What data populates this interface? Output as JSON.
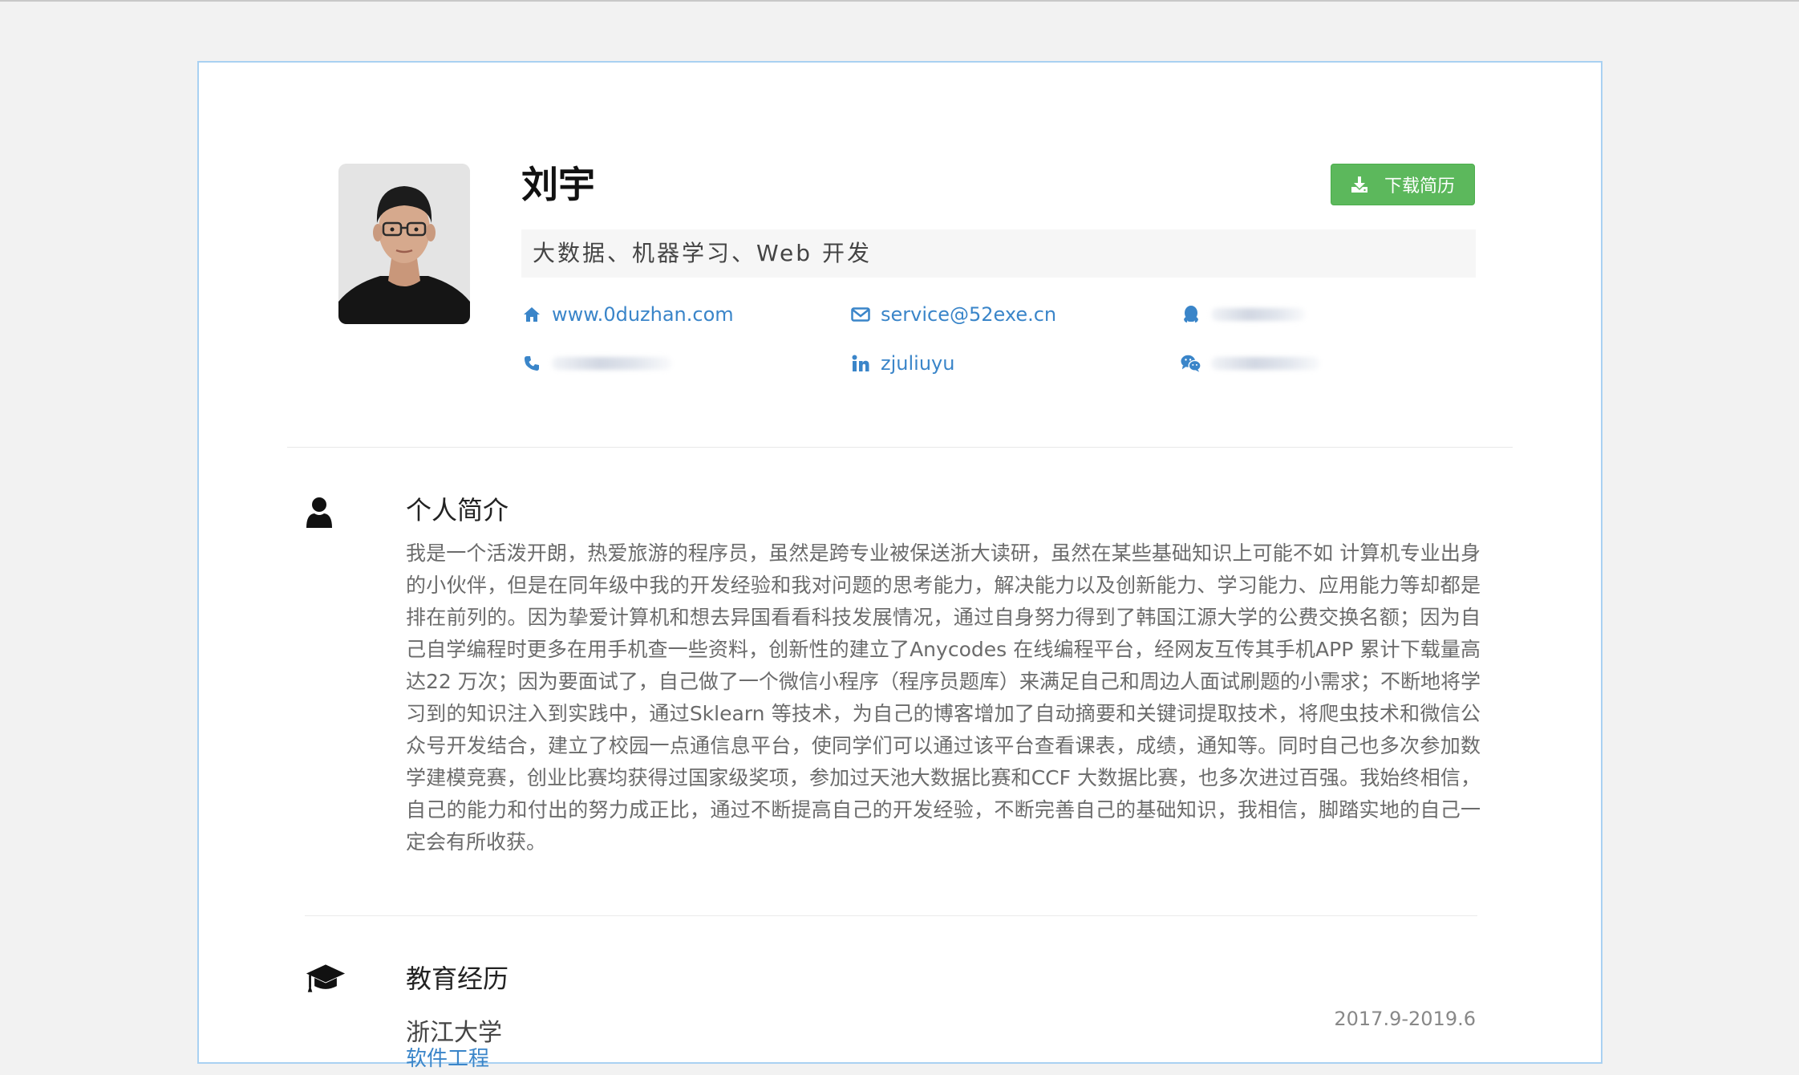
{
  "profile": {
    "name": "刘宇",
    "tagline": "大数据、机器学习、Web 开发",
    "download_label": "下载简历"
  },
  "contacts": {
    "website": "www.0duzhan.com",
    "email": "service@52exe.cn",
    "qq": "",
    "phone": "",
    "linkedin": "zjuliuyu",
    "wechat": ""
  },
  "about": {
    "title": "个人简介",
    "body": "我是一个活泼开朗，热爱旅游的程序员，虽然是跨专业被保送浙大读研，虽然在某些基础知识上可能不如 计算机专业出身的小伙伴，但是在同年级中我的开发经验和我对问题的思考能力，解决能力以及创新能力、学习能力、应用能力等却都是排在前列的。因为挚爱计算机和想去异国看看科技发展情况，通过自身努力得到了韩国江源大学的公费交换名额；因为自己自学编程时更多在用手机查一些资料，创新性的建立了Anycodes 在线编程平台，经网友互传其手机APP 累计下载量高达22 万次；因为要面试了，自己做了一个微信小程序（程序员题库）来满足自己和周边人面试刷题的小需求；不断地将学习到的知识注入到实践中，通过Sklearn 等技术，为自己的博客增加了自动摘要和关键词提取技术，将爬虫技术和微信公众号开发结合，建立了校园一点通信息平台，使同学们可以通过该平台查看课表，成绩，通知等。同时自己也多次参加数学建模竞赛，创业比赛均获得过国家级奖项，参加过天池大数据比赛和CCF 大数据比赛，也多次进过百强。我始终相信，自己的能力和付出的努力成正比，通过不断提高自己的开发经验，不断完善自己的基础知识，我相信，脚踏实地的自己一定会有所收获。"
  },
  "education": {
    "title": "教育经历",
    "items": [
      {
        "school": "浙江大学",
        "major": "软件工程",
        "date": "2017.9-2019.6"
      }
    ]
  },
  "icons": {
    "download": "download-icon",
    "website": "home-icon",
    "email": "envelope-icon",
    "qq": "qq-icon",
    "phone": "phone-icon",
    "linkedin": "linkedin-icon",
    "wechat": "wechat-icon",
    "about": "user-icon",
    "education": "graduation-cap-icon"
  },
  "colors": {
    "accent": "#3a85c9",
    "download_button": "#5cb85c",
    "card_border": "#a9d1f2",
    "page_background": "#f2f2f2"
  }
}
